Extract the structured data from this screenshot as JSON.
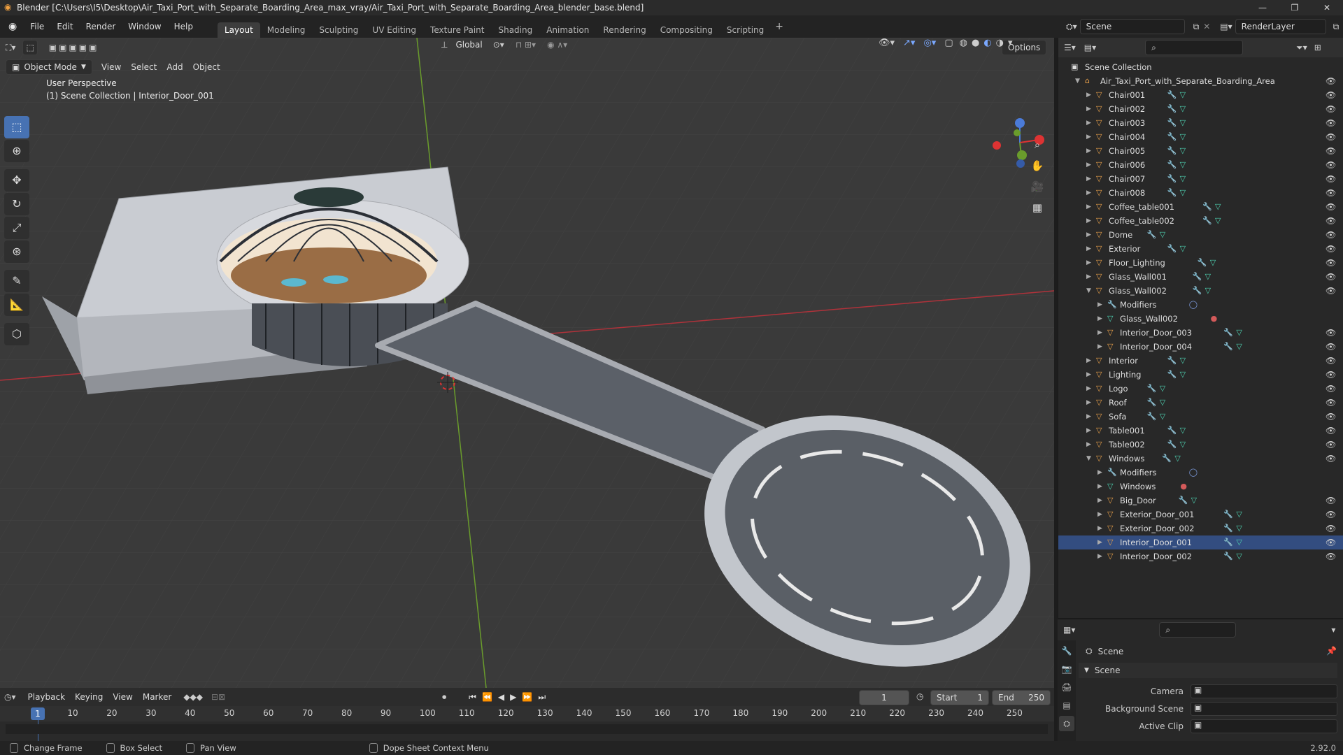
{
  "window": {
    "title": "Blender [C:\\Users\\I5\\Desktop\\Air_Taxi_Port_with_Separate_Boarding_Area_max_vray/Air_Taxi_Port_with_Separate_Boarding_Area_blender_base.blend]",
    "version": "2.92.0"
  },
  "menu": [
    "File",
    "Edit",
    "Render",
    "Window",
    "Help"
  ],
  "workspaces": [
    "Layout",
    "Modeling",
    "Sculpting",
    "UV Editing",
    "Texture Paint",
    "Shading",
    "Animation",
    "Rendering",
    "Compositing",
    "Scripting"
  ],
  "active_workspace": "Layout",
  "scene": {
    "name": "Scene",
    "render_layer": "RenderLayer"
  },
  "viewport": {
    "orientation": "Global",
    "options": "Options",
    "mode": "Object Mode",
    "menus": [
      "View",
      "Select",
      "Add",
      "Object"
    ],
    "perspective": "User Perspective",
    "context": "(1) Scene Collection | Interior_Door_001"
  },
  "outliner": {
    "root": "Scene Collection",
    "collection": "Air_Taxi_Port_with_Separate_Boarding_Area",
    "items": [
      {
        "label": "Chair001",
        "level": 1
      },
      {
        "label": "Chair002",
        "level": 1
      },
      {
        "label": "Chair003",
        "level": 1
      },
      {
        "label": "Chair004",
        "level": 1
      },
      {
        "label": "Chair005",
        "level": 1
      },
      {
        "label": "Chair006",
        "level": 1
      },
      {
        "label": "Chair007",
        "level": 1
      },
      {
        "label": "Chair008",
        "level": 1
      },
      {
        "label": "Coffee_table001",
        "level": 1
      },
      {
        "label": "Coffee_table002",
        "level": 1
      },
      {
        "label": "Dome",
        "level": 1
      },
      {
        "label": "Exterior",
        "level": 1
      },
      {
        "label": "Floor_Lighting",
        "level": 1
      },
      {
        "label": "Glass_Wall001",
        "level": 1
      },
      {
        "label": "Glass_Wall002",
        "level": 1,
        "expanded": true
      },
      {
        "label": "Modifiers",
        "level": 2,
        "kind": "modifiers"
      },
      {
        "label": "Glass_Wall002",
        "level": 2,
        "kind": "mesh"
      },
      {
        "label": "Interior_Door_003",
        "level": 2
      },
      {
        "label": "Interior_Door_004",
        "level": 2
      },
      {
        "label": "Interior",
        "level": 1
      },
      {
        "label": "Lighting",
        "level": 1
      },
      {
        "label": "Logo",
        "level": 1
      },
      {
        "label": "Roof",
        "level": 1
      },
      {
        "label": "Sofa",
        "level": 1
      },
      {
        "label": "Table001",
        "level": 1
      },
      {
        "label": "Table002",
        "level": 1
      },
      {
        "label": "Windows",
        "level": 1,
        "expanded": true
      },
      {
        "label": "Modifiers",
        "level": 2,
        "kind": "modifiers"
      },
      {
        "label": "Windows",
        "level": 2,
        "kind": "mesh"
      },
      {
        "label": "Big_Door",
        "level": 2
      },
      {
        "label": "Exterior_Door_001",
        "level": 2
      },
      {
        "label": "Exterior_Door_002",
        "level": 2
      },
      {
        "label": "Interior_Door_001",
        "level": 2,
        "selected": true
      },
      {
        "label": "Interior_Door_002",
        "level": 2
      }
    ]
  },
  "properties": {
    "breadcrumb": "Scene",
    "panel": "Scene",
    "fields": [
      {
        "label": "Camera"
      },
      {
        "label": "Background Scene"
      },
      {
        "label": "Active Clip"
      }
    ]
  },
  "timeline": {
    "menus": [
      "Playback",
      "Keying",
      "View",
      "Marker"
    ],
    "current_frame": "1",
    "start_label": "Start",
    "start": "1",
    "end_label": "End",
    "end": "250",
    "ticks": [
      "10",
      "20",
      "30",
      "40",
      "50",
      "60",
      "70",
      "80",
      "90",
      "100",
      "110",
      "120",
      "130",
      "140",
      "150",
      "160",
      "170",
      "180",
      "190",
      "200",
      "210",
      "220",
      "230",
      "240",
      "250"
    ]
  },
  "status": [
    "Change Frame",
    "Box Select",
    "Pan View",
    "Dope Sheet Context Menu"
  ],
  "colors": {
    "accent": "#4772b3",
    "object": "#e8a04a",
    "mesh": "#4ed0b0",
    "modifier": "#7e9de0",
    "grid_x": "#b0323a",
    "grid_y": "#6a9c2c"
  }
}
